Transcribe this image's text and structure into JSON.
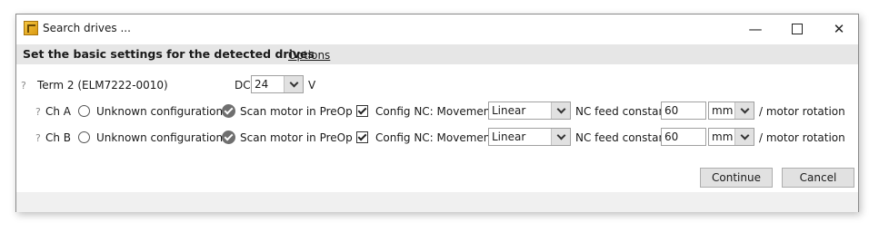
{
  "window": {
    "title": "Search drives ..."
  },
  "header": {
    "title": "Set the basic settings for the detected drives",
    "options_label": "Options"
  },
  "term": {
    "help": "?",
    "name": "Term 2 (ELM7222-0010)",
    "dc_label": "DC",
    "dc_value": "24",
    "dc_unit": "V"
  },
  "channels": [
    {
      "help": "?",
      "name": "Ch A",
      "unknown_label": "Unknown configuration.",
      "scan_label": "Scan motor in PreOp",
      "config_label": "Config NC: Movement",
      "movement_value": "Linear",
      "feed_label": "NC feed constant",
      "feed_value": "60",
      "feed_unit": "mm",
      "rotation_label": "/ motor rotation"
    },
    {
      "help": "?",
      "name": "Ch B",
      "unknown_label": "Unknown configuration.",
      "scan_label": "Scan motor in PreOp",
      "config_label": "Config NC: Movement",
      "movement_value": "Linear",
      "feed_label": "NC feed constant",
      "feed_value": "60",
      "feed_unit": "mm",
      "rotation_label": "/ motor rotation"
    }
  ],
  "buttons": {
    "continue": "Continue",
    "cancel": "Cancel"
  }
}
